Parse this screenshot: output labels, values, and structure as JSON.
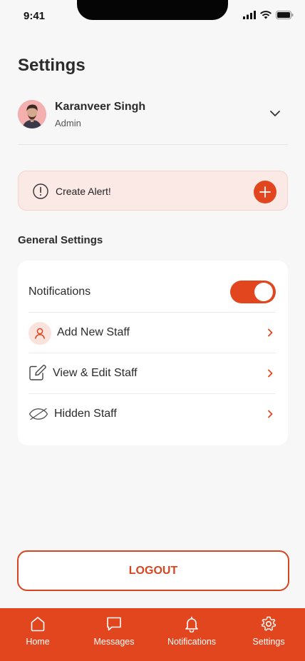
{
  "status_bar": {
    "time": "9:41"
  },
  "page": {
    "title": "Settings"
  },
  "profile": {
    "name": "Karanveer Singh",
    "role": "Admin"
  },
  "alert": {
    "label": "Create Alert!"
  },
  "general_settings": {
    "title": "General Settings",
    "items": [
      {
        "label": "Notifications",
        "icon": "toggle",
        "toggle_on": true
      },
      {
        "label": "Add New Staff",
        "icon": "user-icon"
      },
      {
        "label": "View & Edit Staff",
        "icon": "edit-icon"
      },
      {
        "label": "Hidden Staff",
        "icon": "eye-off-icon"
      }
    ]
  },
  "logout": {
    "label": "LOGOUT"
  },
  "tabbar": {
    "items": [
      {
        "label": "Home",
        "icon": "home-icon"
      },
      {
        "label": "Messages",
        "icon": "message-icon"
      },
      {
        "label": "Notifications",
        "icon": "bell-icon"
      },
      {
        "label": "Settings",
        "icon": "gear-icon"
      }
    ]
  },
  "colors": {
    "accent": "#e2461f",
    "alert_bg": "#fbe9e5",
    "background": "#f7f7f7"
  }
}
